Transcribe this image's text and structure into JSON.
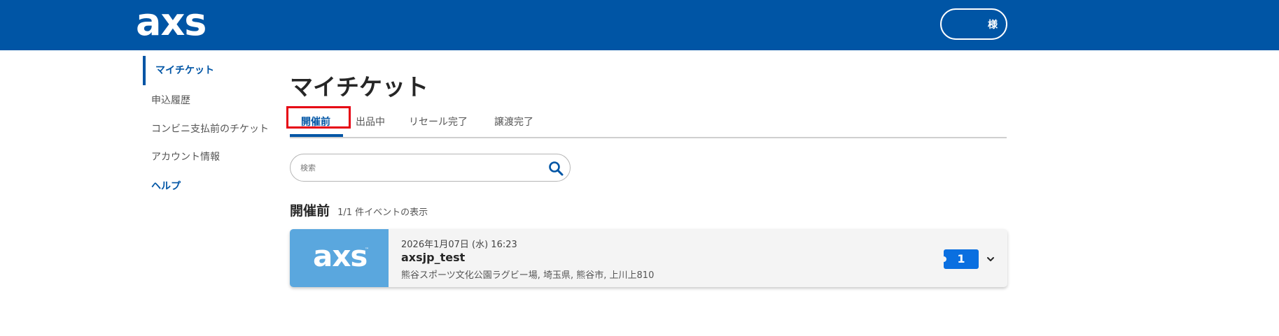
{
  "header": {
    "logo": "axs",
    "user_name": "",
    "user_suffix": "様"
  },
  "sidebar": {
    "items": [
      {
        "label": "マイチケット",
        "active": true
      },
      {
        "label": "申込履歴"
      },
      {
        "label": "コンビニ支払前のチケット"
      },
      {
        "label": "アカウント情報"
      },
      {
        "label": "ヘルプ"
      }
    ]
  },
  "main": {
    "title": "マイチケット",
    "tabs": [
      {
        "label": "開催前",
        "active": true
      },
      {
        "label": "出品中"
      },
      {
        "label": "リセール完了"
      },
      {
        "label": "譲渡完了"
      }
    ],
    "search": {
      "placeholder": "検索"
    },
    "section": {
      "title": "開催前",
      "count_text": "1/1 件イベントの表示"
    },
    "events": [
      {
        "thumb_logo": "axs",
        "thumb_tm": "™",
        "date": "2026年1月07日 (水) 16:23",
        "name": "axsjp_test",
        "venue": "熊谷スポーツ文化公園ラグビー場, 埼玉県, 熊谷市, 上川上810",
        "ticket_count": "1"
      }
    ]
  },
  "colors": {
    "brand": "#0055a5",
    "thumb": "#5aa7de",
    "ticket_badge": "#0a6fe0",
    "highlight": "#e60012"
  }
}
